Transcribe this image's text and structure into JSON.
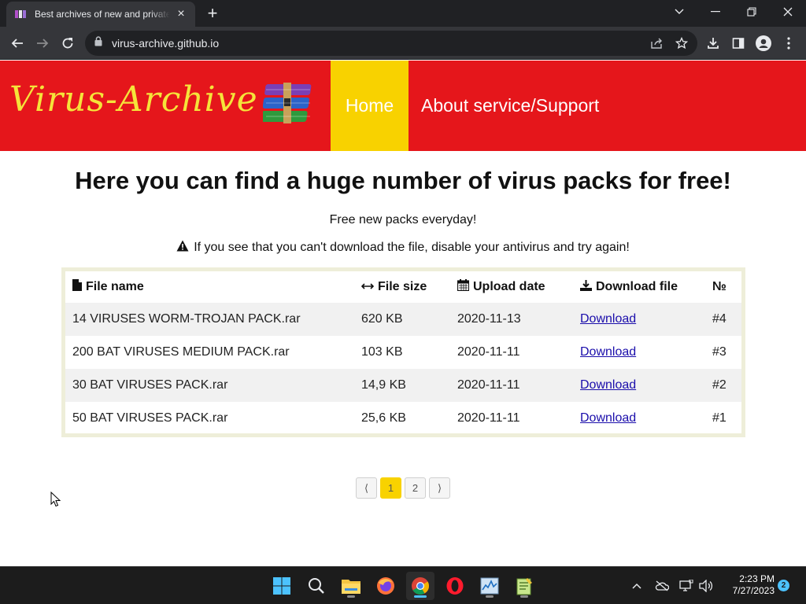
{
  "browser": {
    "tab_title": "Best archives of new and private",
    "url": "virus-archive.github.io",
    "new_tab_symbol": "+",
    "close_tab_symbol": "×"
  },
  "site": {
    "logo_text": "Virus-Archive",
    "nav": {
      "home": "Home",
      "about": "About service/Support"
    },
    "colors": {
      "header_red": "#e5161b",
      "home_yellow": "#f8d200",
      "logo_yellow": "#f5e43a"
    }
  },
  "content": {
    "headline": "Here you can find a huge number of virus packs for free!",
    "subline": "Free new packs everyday!",
    "warning": "If you see that you can't download the file, disable your antivirus and try again!"
  },
  "table": {
    "headers": {
      "name": "File name",
      "size": "File size",
      "date": "Upload date",
      "download": "Download file",
      "number": "№"
    },
    "rows": [
      {
        "name": "14 VIRUSES WORM-TROJAN PACK.rar",
        "size": "620 KB",
        "date": "2020-11-13",
        "link": "Download",
        "num": "#4"
      },
      {
        "name": "200 BAT VIRUSES MEDIUM PACK.rar",
        "size": "103 KB",
        "date": "2020-11-11",
        "link": "Download",
        "num": "#3"
      },
      {
        "name": "30 BAT VIRUSES PACK.rar",
        "size": "14,9 KB",
        "date": "2020-11-11",
        "link": "Download",
        "num": "#2"
      },
      {
        "name": "50 BAT VIRUSES PACK.rar",
        "size": "25,6 KB",
        "date": "2020-11-11",
        "link": "Download",
        "num": "#1"
      }
    ]
  },
  "pagination": {
    "prev": "⟨",
    "pages": [
      "1",
      "2"
    ],
    "current": "1",
    "next": "⟩"
  },
  "taskbar": {
    "apps": [
      "start-icon",
      "search-icon",
      "file-explorer-icon",
      "firefox-icon",
      "chrome-icon",
      "opera-icon",
      "task-manager-icon",
      "notepad-icon"
    ],
    "time": "2:23 PM",
    "date": "7/27/2023",
    "notification_count": "2"
  }
}
